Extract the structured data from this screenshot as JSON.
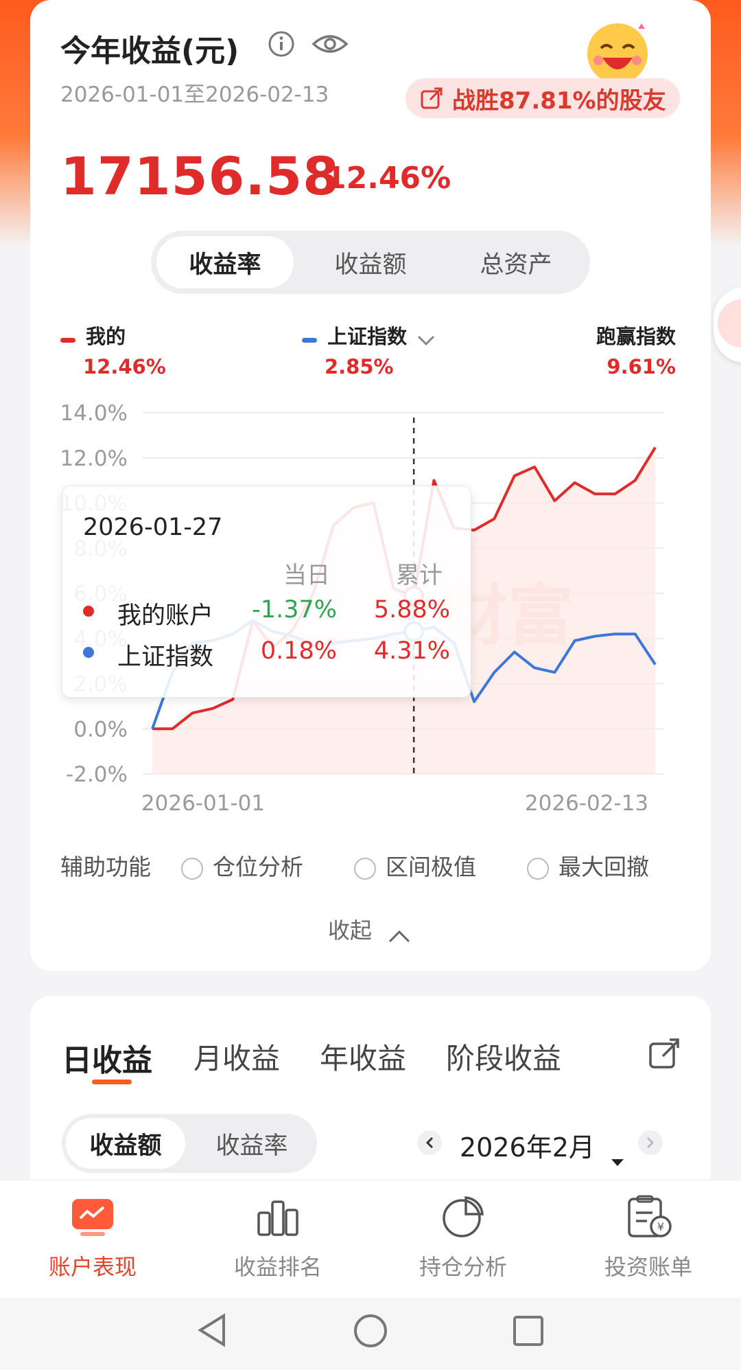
{
  "header": {
    "title": "今年收益(元)",
    "date_range": "2026-01-01至2026-02-13",
    "beat_badge": "战胜87.81%的股友",
    "total_value": "17156.58",
    "total_rate": "12.46%"
  },
  "main_tabs": [
    "收益率",
    "收益额",
    "总资产"
  ],
  "legend": {
    "mine_name": "我的",
    "mine_value": "12.46%",
    "index_name": "上证指数",
    "index_value": "2.85%",
    "beat_name": "跑赢指数",
    "beat_value": "9.61%"
  },
  "chart_data": {
    "type": "line",
    "y_ticks": [
      "14.0%",
      "12.0%",
      "10.0%",
      "8.0%",
      "6.0%",
      "4.0%",
      "2.0%",
      "0.0%",
      "-2.0%"
    ],
    "ylim": [
      -2,
      14
    ],
    "x_labels": [
      "2026-01-01",
      "2026-02-13"
    ],
    "series": [
      {
        "name": "我的",
        "color": "#e02b2b",
        "values": [
          0.0,
          0.0,
          0.7,
          0.9,
          1.3,
          4.8,
          3.6,
          4.4,
          6.0,
          9.0,
          9.8,
          10.0,
          6.2,
          5.88,
          11.0,
          8.9,
          8.8,
          9.3,
          11.2,
          11.6,
          10.1,
          10.9,
          10.4,
          10.4,
          11.0,
          12.46
        ]
      },
      {
        "name": "上证指数",
        "color": "#3d78d8",
        "values": [
          0.0,
          2.5,
          3.8,
          3.9,
          4.2,
          4.8,
          4.3,
          4.1,
          3.7,
          3.8,
          3.9,
          4.0,
          4.2,
          4.31,
          4.5,
          3.8,
          1.2,
          2.5,
          3.4,
          2.7,
          2.5,
          3.9,
          4.1,
          4.2,
          4.2,
          2.85
        ]
      }
    ],
    "highlight_index": 13,
    "tooltip": {
      "date": "2026-01-27",
      "col_day": "当日",
      "col_total": "累计",
      "rows": [
        {
          "name": "我的账户",
          "day": "-1.37%",
          "total": "5.88%",
          "color": "#e02b2b",
          "day_color": "#2ea44f"
        },
        {
          "name": "上证指数",
          "day": "0.18%",
          "total": "4.31%",
          "color": "#3d78d8",
          "day_color": "#e02b2b"
        }
      ]
    },
    "watermark": "财富"
  },
  "aux": {
    "label": "辅助功能",
    "options": [
      "仓位分析",
      "区间极值",
      "最大回撤"
    ],
    "collapse": "收起"
  },
  "section2": {
    "tabs": [
      "日收益",
      "月收益",
      "年收益",
      "阶段收益"
    ],
    "seg": [
      "收益额",
      "收益率"
    ],
    "month": "2026年2月"
  },
  "bottom_nav": [
    "账户表现",
    "收益排名",
    "持仓分析",
    "投资账单"
  ],
  "colors": {
    "accent": "#e02b2b",
    "orange": "#ff5a1f",
    "blue": "#3d78d8"
  }
}
